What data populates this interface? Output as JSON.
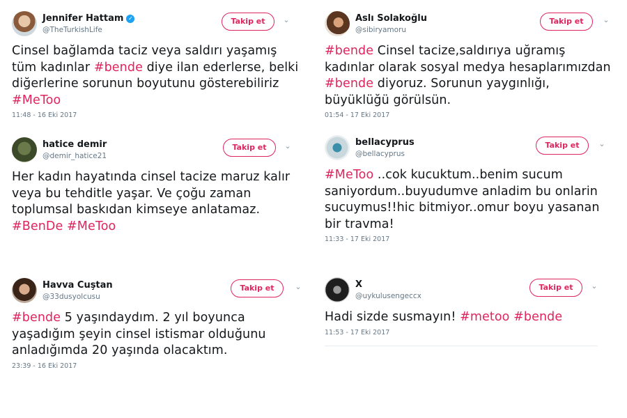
{
  "follow_label": "Takip et",
  "colors": {
    "hashtag": "#e0245e",
    "verified": "#1da1f2",
    "meta": "#657786"
  },
  "tweets": [
    {
      "name": "Jennifer Hattam",
      "verified": true,
      "handle": "@TheTurkishLife",
      "lines": [
        [
          {
            "t": "Cinsel bağlamda taciz veya saldırı yaşamış"
          }
        ],
        [
          {
            "t": "tüm kadınlar "
          },
          {
            "t": "#bende",
            "tag": true
          },
          {
            "t": " diye ilan ederlerse, belki"
          }
        ],
        [
          {
            "t": "diğerlerine sorunun boyutunu gösterebiliriz"
          }
        ],
        [
          {
            "t": "#MeToo",
            "tag": true
          }
        ]
      ],
      "time": "11:48 - 16 Eki 2017"
    },
    {
      "name": "Aslı Solakoğlu",
      "verified": false,
      "handle": "@sibiryamoru",
      "lines": [
        [
          {
            "t": "#bende",
            "tag": true
          },
          {
            "t": " Cinsel tacize,saldırıya uğramış"
          }
        ],
        [
          {
            "t": "kadınlar olarak sosyal medya hesaplarımızdan"
          }
        ],
        [
          {
            "t": "#bende",
            "tag": true
          },
          {
            "t": " diyoruz. Sorunun yaygınlığı,"
          }
        ],
        [
          {
            "t": "büyüklüğü görülsün."
          }
        ]
      ],
      "time": "01:54 - 17 Eki 2017"
    },
    {
      "name": "hatice demir",
      "verified": false,
      "handle": "@demir_hatice21",
      "lines": [
        [
          {
            "t": "Her kadın hayatında cinsel tacize maruz kalır"
          }
        ],
        [
          {
            "t": "veya bu tehditle yaşar. Ve çoğu zaman"
          }
        ],
        [
          {
            "t": "toplumsal baskıdan kimseye anlatamaz."
          }
        ],
        [
          {
            "t": "#BenDe",
            "tag": true
          },
          {
            "t": " "
          },
          {
            "t": "#MeToo",
            "tag": true
          }
        ]
      ],
      "time": ""
    },
    {
      "name": "bellacyprus",
      "verified": false,
      "handle": "@bellacyprus",
      "lines": [
        [
          {
            "t": "#MeToo",
            "tag": true
          },
          {
            "t": " ..cok kucuktum..benim sucum"
          }
        ],
        [
          {
            "t": "saniyordum..buyudumve anladim bu onlarin"
          }
        ],
        [
          {
            "t": "sucuymus!!hic bitmiyor..omur boyu yasanan"
          }
        ],
        [
          {
            "t": "bir travma!"
          }
        ]
      ],
      "time": "11:33 - 17 Eki 2017"
    },
    {
      "name": "Havva Cuştan",
      "verified": false,
      "handle": "@33dusyolcusu",
      "lines": [
        [
          {
            "t": "#bende",
            "tag": true
          },
          {
            "t": " 5 yaşındaydım. 2 yıl boyunca"
          }
        ],
        [
          {
            "t": "yaşadığım şeyin cinsel istismar olduğunu"
          }
        ],
        [
          {
            "t": "anladığımda 20 yaşında olacaktım."
          }
        ]
      ],
      "time": "23:39 - 16 Eki 2017"
    },
    {
      "name": "X",
      "verified": false,
      "handle": "@uykulusengeccx",
      "lines": [
        [
          {
            "t": "Hadi sizde susmayın! "
          },
          {
            "t": "#metoo",
            "tag": true
          },
          {
            "t": " "
          },
          {
            "t": "#bende",
            "tag": true
          }
        ]
      ],
      "time": "11:53 - 17 Eki 2017"
    }
  ]
}
